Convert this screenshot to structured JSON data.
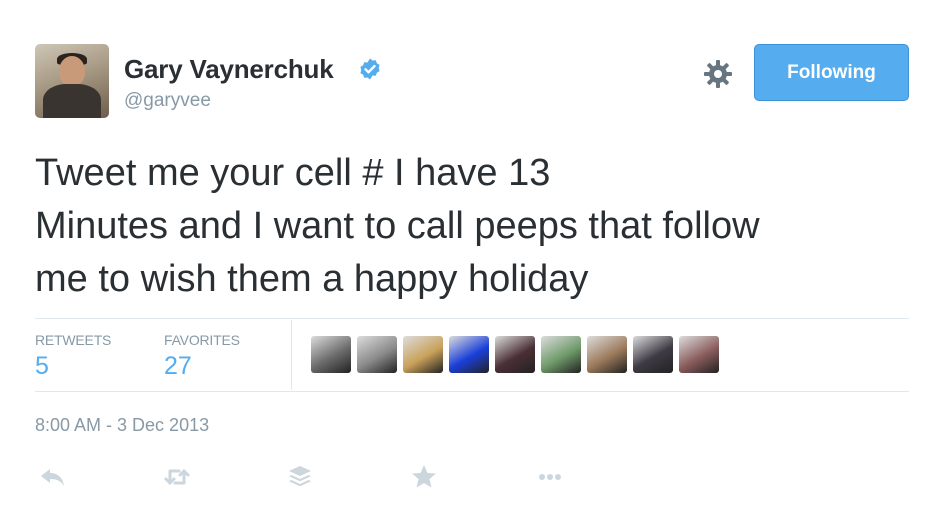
{
  "author": {
    "name": "Gary Vaynerchuk",
    "handle": "@garyvee",
    "verified": true
  },
  "follow_button": {
    "label": "Following",
    "color": "#55acee"
  },
  "tweet": {
    "lines": [
      "Tweet me your cell # I have 13",
      "Minutes and I want to call peeps that follow",
      "me to wish them a happy holiday"
    ]
  },
  "stats": {
    "retweets": {
      "label": "RETWEETS",
      "value": "5"
    },
    "favorites": {
      "label": "FAVORITES",
      "value": "27"
    }
  },
  "favoriter_avatars": [
    {
      "color": "#6b6b6b"
    },
    {
      "color": "#8a8a8a"
    },
    {
      "color": "#c9a15a"
    },
    {
      "color": "#1a3fd9"
    },
    {
      "color": "#4a2f36"
    },
    {
      "color": "#6f9a6a"
    },
    {
      "color": "#9c7a5b"
    },
    {
      "color": "#3e3a44"
    },
    {
      "color": "#8b5d5d"
    }
  ],
  "timestamp": "8:00 AM - 3 Dec 2013",
  "actions": [
    {
      "name": "reply-icon"
    },
    {
      "name": "retweet-icon"
    },
    {
      "name": "buffer-icon"
    },
    {
      "name": "favorite-icon"
    },
    {
      "name": "more-icon"
    }
  ],
  "colors": {
    "text": "#292f33",
    "muted": "#8899a6",
    "accent": "#55acee",
    "action_icon": "#ccd6dd"
  }
}
